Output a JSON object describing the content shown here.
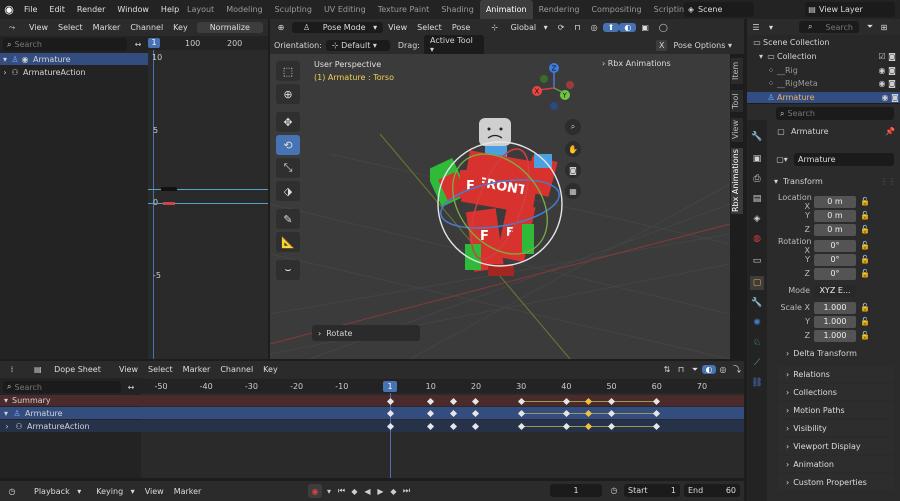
{
  "topbar": {
    "menus": [
      "File",
      "Edit",
      "Render",
      "Window",
      "Help"
    ],
    "workspaces": [
      "Layout",
      "Modeling",
      "Sculpting",
      "UV Editing",
      "Texture Paint",
      "Shading",
      "Animation",
      "Rendering",
      "Compositing",
      "Scriptin"
    ],
    "active_workspace": "Animation",
    "scene": "Scene",
    "view_layer": "View Layer"
  },
  "graph_editor": {
    "menus": [
      "View",
      "Select",
      "Marker",
      "Channel",
      "Key"
    ],
    "normalize_label": "Normalize",
    "search_placeholder": "Search",
    "ruler": [
      "1",
      "100",
      "200"
    ],
    "y_ticks": [
      "10",
      "5",
      "0",
      "-5"
    ],
    "channels": [
      "Armature",
      "ArmatureAction"
    ]
  },
  "viewport": {
    "mode": "Pose Mode",
    "menus": [
      "View",
      "Select",
      "Pose"
    ],
    "transform_orientation": "Global",
    "orientation_label": "Orientation:",
    "orientation_value": "Default",
    "drag_label": "Drag:",
    "drag_value": "Active Tool",
    "pose_options": "Pose Options",
    "view_name": "User Perspective",
    "object_info": "(1) Armature : Torso",
    "addon_panel": "Rbx Animations",
    "last_op": "Rotate",
    "side_tabs": [
      "Item",
      "Tool",
      "View",
      "Rbx Animations"
    ],
    "gizmo": {
      "x": "X",
      "y": "Y",
      "z": "Z"
    },
    "front_label": "FRONT",
    "decal": "F"
  },
  "outliner": {
    "search_placeholder": "Search",
    "items": [
      "Scene Collection",
      "Collection",
      "__Rig",
      "__RigMeta",
      "Armature"
    ]
  },
  "properties": {
    "search_placeholder": "Search",
    "object_name": "Armature",
    "datablock": "Armature",
    "transform_label": "Transform",
    "location_label": "Location",
    "rotation_label": "Rotation",
    "scale_label": "Scale",
    "axes": [
      "X",
      "Y",
      "Z"
    ],
    "location": [
      "0 m",
      "0 m",
      "0 m"
    ],
    "rotation": [
      "0°",
      "0°",
      "0°"
    ],
    "mode_label": "Mode",
    "mode_value": "XYZ E...",
    "scale": [
      "1.000",
      "1.000",
      "1.000"
    ],
    "delta_transform": "Delta Transform",
    "sections": [
      "Relations",
      "Collections",
      "Motion Paths",
      "Visibility",
      "Viewport Display",
      "Animation",
      "Custom Properties"
    ]
  },
  "dopesheet": {
    "mode": "Dope Sheet",
    "menus": [
      "View",
      "Select",
      "Marker",
      "Channel",
      "Key"
    ],
    "search_placeholder": "Search",
    "ruler": [
      "-50",
      "-40",
      "-30",
      "-20",
      "-10",
      "1",
      "10",
      "20",
      "30",
      "40",
      "50",
      "60",
      "70"
    ],
    "current_frame_label": "1",
    "channels": [
      "Summary",
      "Armature",
      "ArmatureAction"
    ],
    "keyframes": [
      1,
      10,
      15,
      20,
      30,
      40,
      45,
      50,
      60
    ],
    "selected_keyframes": [
      45
    ]
  },
  "timeline": {
    "menus": [
      "Playback",
      "Keying",
      "View",
      "Marker"
    ],
    "current_frame": "1",
    "start_label": "Start",
    "start": "1",
    "end_label": "End",
    "end": "60"
  },
  "colors": {
    "accent": "#4772b3",
    "selected_row": "#334d80",
    "summary_row": "#4a2a2a",
    "keyframe_selected": "#f0c040",
    "red_part": "#d8322e",
    "green_part": "#2fba3a",
    "blue_part": "#4aa0e0"
  }
}
